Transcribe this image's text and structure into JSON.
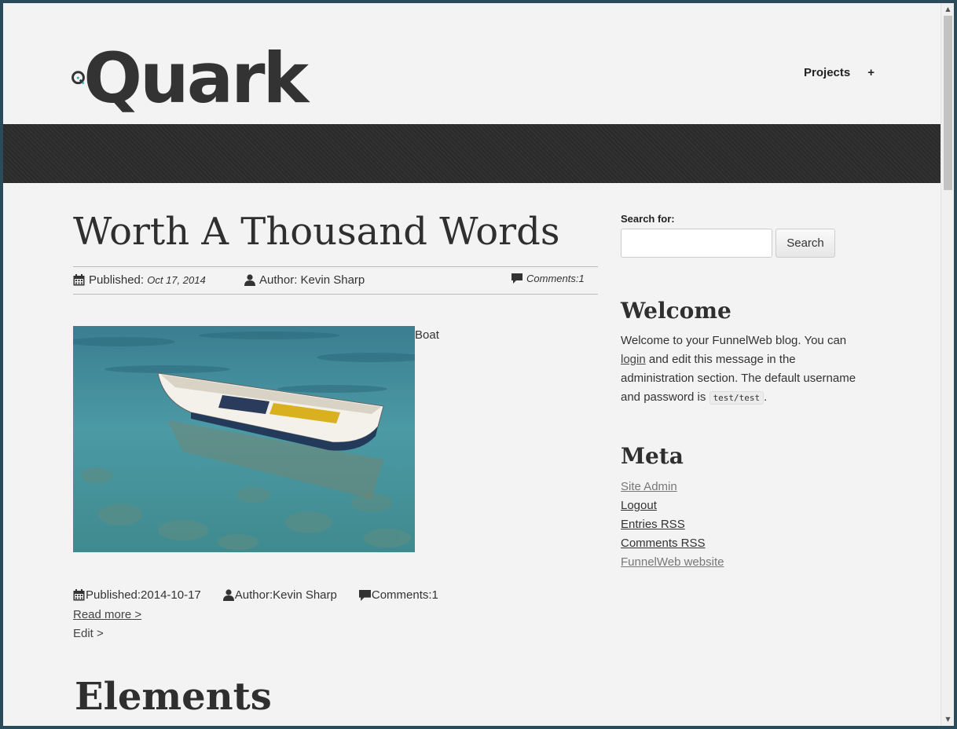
{
  "header": {
    "logo_text": "Quark",
    "nav_projects": "Projects",
    "nav_plus": "+"
  },
  "post": {
    "title": "Worth A Thousand Words",
    "published_label": "Published:",
    "published_date": "Oct 17, 2014",
    "author_label": "Author: Kevin Sharp",
    "comments_label": "Comments:1",
    "image_alt": "Boat",
    "footer": {
      "published": "Published:2014-10-17",
      "author": "Author:Kevin Sharp",
      "comments": "Comments:1"
    },
    "read_more": "Read more >",
    "edit": "Edit >"
  },
  "next_post_title": "Elements",
  "sidebar": {
    "search_label": "Search for:",
    "search_value": "",
    "search_button": "Search",
    "welcome_title": "Welcome",
    "welcome_before_login": "Welcome to your FunnelWeb blog. You can ",
    "welcome_login": "login",
    "welcome_after_login": " and edit this message in the administration section. The default username and password is ",
    "welcome_code": "test/test",
    "welcome_end": ".",
    "meta_title": "Meta",
    "meta_links": [
      "Site Admin",
      "Logout",
      "Entries RSS",
      "Comments RSS",
      "FunnelWeb website"
    ]
  },
  "colors": {
    "accent": "#2aa6b5",
    "text": "#333333",
    "banner": "#2e2e2e",
    "background": "#f3f3f3"
  },
  "icons": {
    "calendar": "calendar-icon",
    "user": "user-icon",
    "comment": "comment-icon"
  }
}
